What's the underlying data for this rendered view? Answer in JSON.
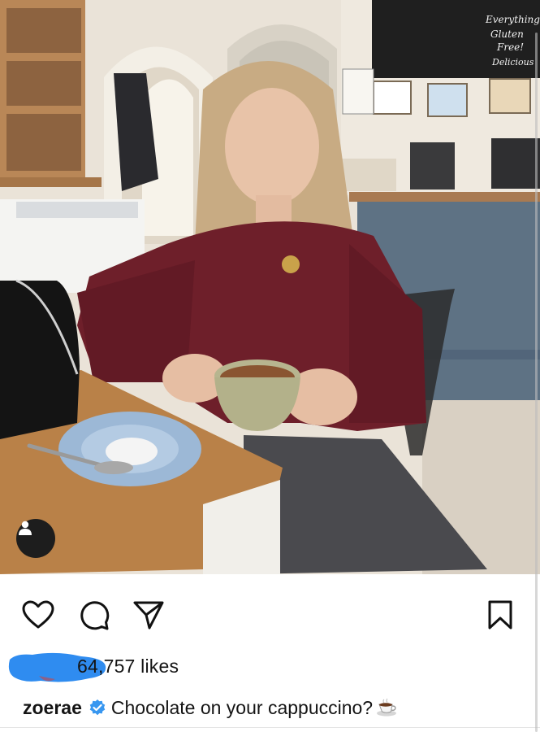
{
  "photo": {
    "alt_subject": "woman-with-cappuccino",
    "chalkboard_text": "Everything Gluten Free! Delicious"
  },
  "actions": {
    "like_icon": "heart-icon",
    "comment_icon": "comment-icon",
    "share_icon": "paper-plane-icon",
    "save_icon": "bookmark-icon"
  },
  "likes": {
    "count_text": "64,757 likes"
  },
  "caption": {
    "username": "zoerae",
    "verified_icon": "verified-badge-icon",
    "text": "Chocolate on your cappuccino?",
    "emoji_icon": "coffee-cup-icon"
  },
  "colors": {
    "sweater": "#6e1f2a",
    "verified_blue": "#3897f0",
    "redaction_blue": "#2f8cf0"
  }
}
